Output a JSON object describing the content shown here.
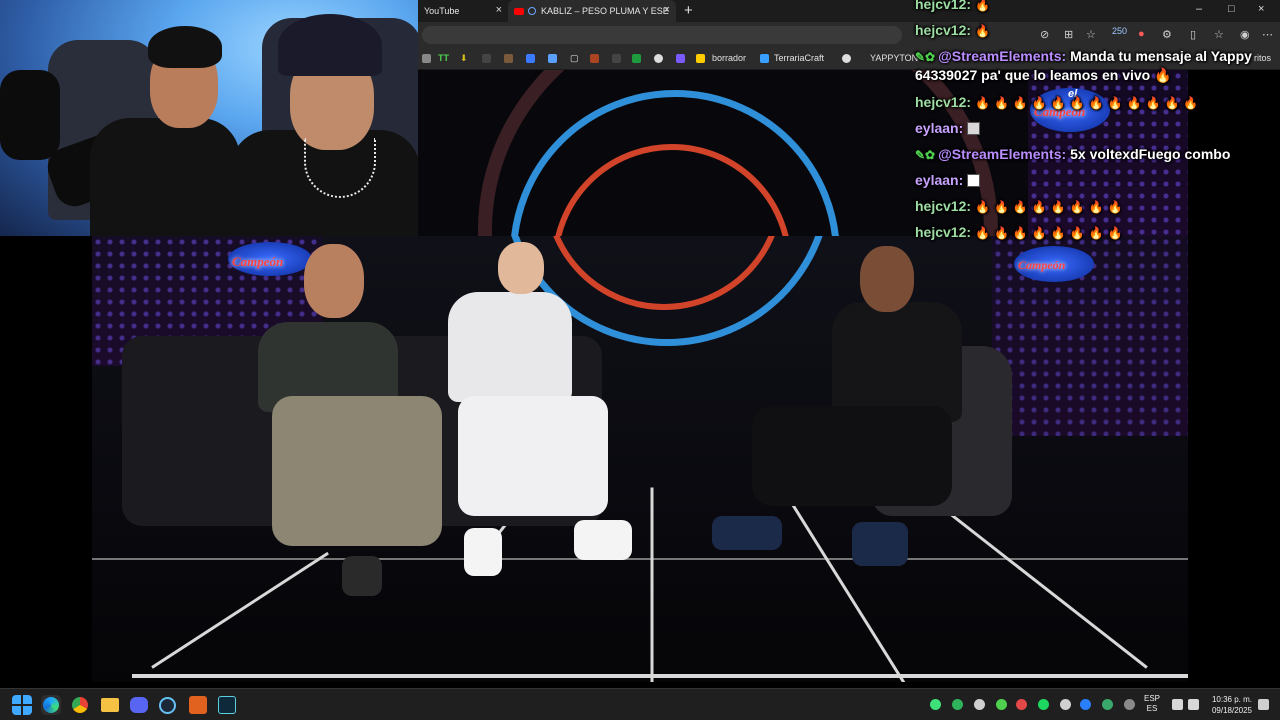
{
  "browser": {
    "tabs": [
      {
        "label": "YouTube",
        "close": "×"
      },
      {
        "label": "KABLIZ – PESO PLUMA Y ESE",
        "close": "×"
      }
    ],
    "new_tab": "+",
    "window_controls": {
      "minimize": "–",
      "maximize": "□",
      "close": "×"
    },
    "bookmarks": [
      {
        "label": "borrador"
      },
      {
        "label": "TerrariaCraft"
      },
      {
        "label": "YAPPYTON"
      },
      {
        "label": "ritos"
      }
    ],
    "toolbar_badge": "250"
  },
  "chat": {
    "messages": [
      {
        "user": "hejcv12:",
        "text": "",
        "fire_count": 1,
        "user_color": "green"
      },
      {
        "user": "hejcv12:",
        "text": "",
        "fire_count": 1,
        "user_color": "green"
      },
      {
        "user": "@StreamElements:",
        "text": "Manda tu mensaje al Yappy",
        "user_color": "se"
      },
      {
        "user": "",
        "text": "64339027 pa' que lo leamos en vivo 🔥",
        "user_color": "se"
      },
      {
        "user": "hejcv12:",
        "text": "",
        "fire_count": 12,
        "user_color": "green"
      },
      {
        "user": "eylaan:",
        "text": "",
        "emote": true,
        "user_color": "purple"
      },
      {
        "user": "@StreamElements:",
        "text": "5x voltexdFuego combo",
        "user_color": "se"
      },
      {
        "user": "eylaan:",
        "text": "",
        "emote": true,
        "user_color": "purple"
      },
      {
        "user": "hejcv12:",
        "text": "",
        "fire_count": 8,
        "user_color": "green"
      },
      {
        "user": "hejcv12:",
        "text": "",
        "fire_count": 8,
        "user_color": "green"
      }
    ]
  },
  "video": {
    "logo_small": "el",
    "logo_main": "Campeón"
  },
  "taskbar": {
    "language": [
      "ESP",
      "ES"
    ],
    "time": "10:36 p. m.",
    "date": "09/18/2025"
  },
  "colors": {
    "chat_user_green": "#9ddca2",
    "chat_user_purple": "#c7a2ff",
    "streamelements": "#b98dff",
    "taskbar": "#1f1f1f",
    "browser_tabbar": "#1c1c1c"
  }
}
